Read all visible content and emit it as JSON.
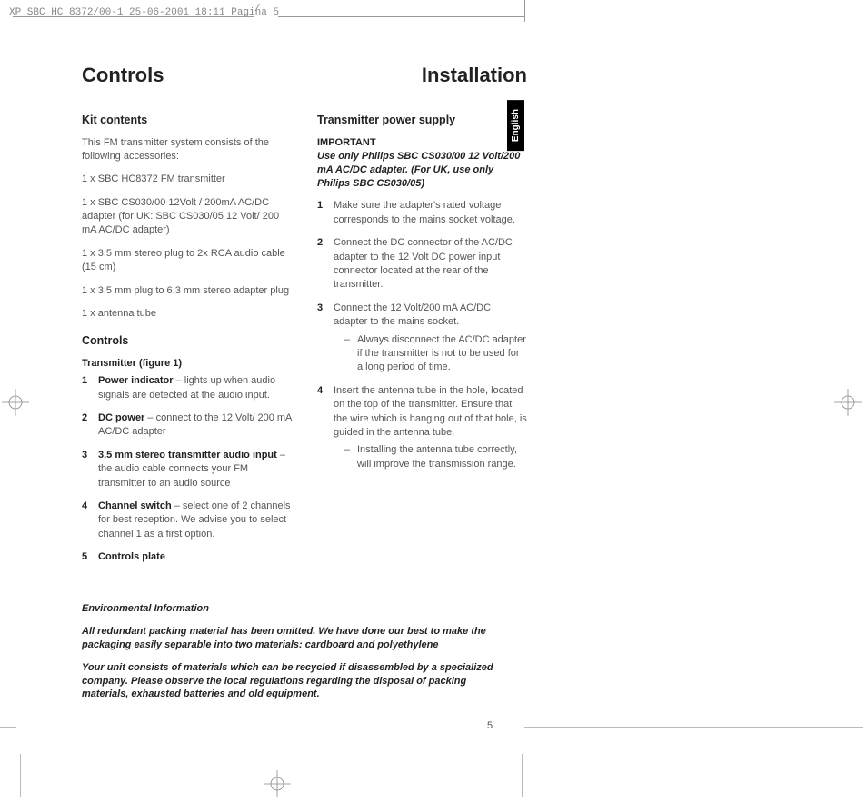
{
  "header": "XP SBC HC 8372/00-1  25-06-2001 18:11  Pagina 5",
  "headings": {
    "left": "Controls",
    "right": "Installation"
  },
  "lang_tab": "English",
  "page_number": "5",
  "left_col": {
    "kit_title": "Kit contents",
    "kit_intro": "This FM transmitter system consists of the following accessories:",
    "kit_items": [
      "1 x SBC HC8372 FM transmitter",
      "1 x SBC CS030/00 12Volt / 200mA AC/DC adapter (for UK: SBC CS030/05 12 Volt/ 200 mA AC/DC adapter)",
      "1 x 3.5 mm stereo plug to 2x RCA audio cable (15 cm)",
      "1 x 3.5 mm plug to 6.3 mm stereo adapter plug",
      "1 x antenna tube"
    ],
    "controls_title": "Controls",
    "controls_sub": "Transmitter (figure 1)",
    "controls": [
      {
        "n": "1",
        "bold": "Power indicator",
        "rest": " – lights up when audio signals are detected at the audio input."
      },
      {
        "n": "2",
        "bold": "DC power",
        "rest": " – connect to the 12 Volt/ 200 mA AC/DC adapter"
      },
      {
        "n": "3",
        "bold": "3.5 mm stereo transmitter audio input",
        "rest": " – the audio cable connects your FM transmitter to an audio source"
      },
      {
        "n": "4",
        "bold": "Channel switch",
        "rest": " – select one of 2 channels for best reception. We advise you to select channel 1 as a first option."
      },
      {
        "n": "5",
        "bold": "Controls plate",
        "rest": ""
      }
    ]
  },
  "right_col": {
    "title": "Transmitter power supply",
    "important_label": "IMPORTANT",
    "important_text": "Use only Philips SBC CS030/00 12 Volt/200 mA AC/DC adapter. (For UK, use only Philips SBC CS030/05)",
    "steps": [
      {
        "n": "1",
        "text": "Make sure the adapter's rated voltage corresponds to the mains socket voltage.",
        "sub": []
      },
      {
        "n": "2",
        "text": "Connect the DC connector of the AC/DC adapter to the 12 Volt DC power input connector located at the rear of the transmitter.",
        "sub": []
      },
      {
        "n": "3",
        "text": "Connect the 12 Volt/200 mA AC/DC adapter to the mains socket.",
        "sub": [
          "Always disconnect the AC/DC adapter if the transmitter is not to be used for a long period of time."
        ]
      },
      {
        "n": "4",
        "text": "Insert the antenna tube in the hole, located on the top of the transmitter. Ensure that the wire which is hanging out of that hole, is guided in the antenna tube.",
        "sub": [
          "Installing the antenna tube correctly, will improve the transmission range."
        ]
      }
    ]
  },
  "env": {
    "title": "Environmental Information",
    "p1": "All redundant packing material has been omitted. We have done our best to make the packaging easily separable into two materials: cardboard and polyethylene",
    "p2": "Your unit consists of materials which can be recycled if disassembled by a specialized company. Please observe the local regulations regarding the disposal of packing materials, exhausted batteries and old equipment."
  }
}
